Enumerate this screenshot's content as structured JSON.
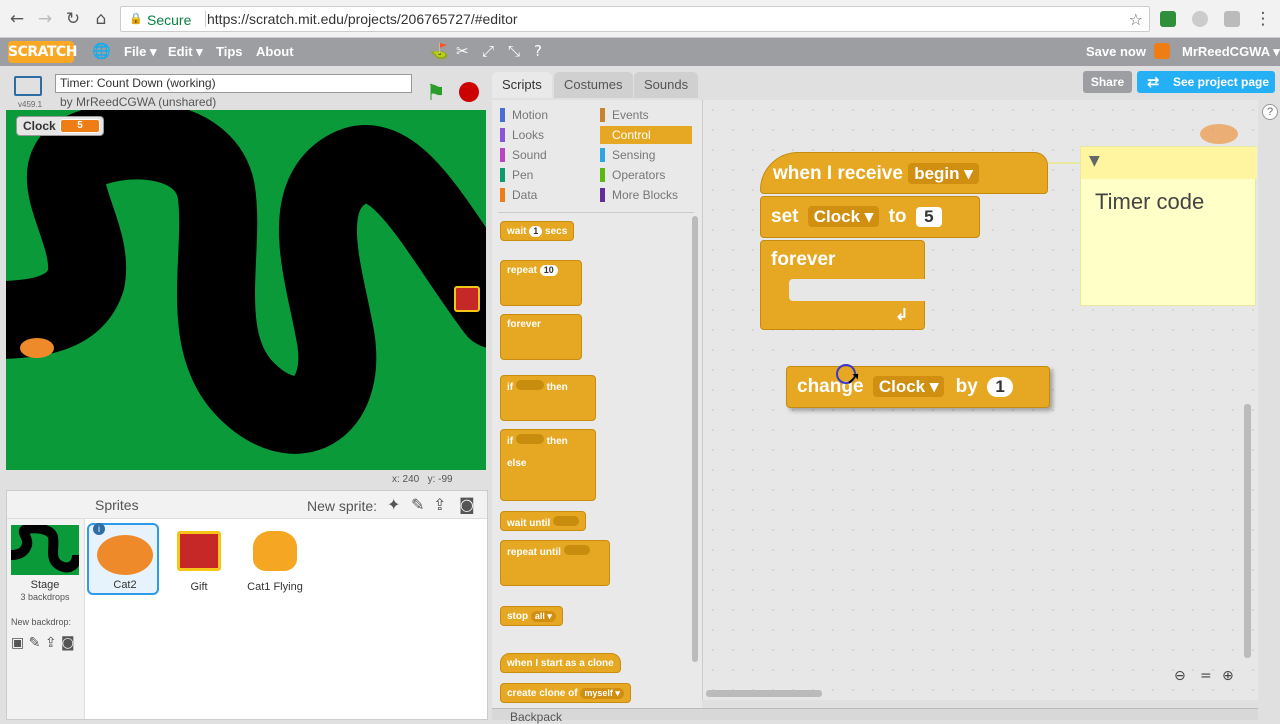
{
  "browser": {
    "secure_label": "Secure",
    "url": "https://scratch.mit.edu/projects/206765727/#editor"
  },
  "menubar": {
    "logo": "SCRATCH",
    "file": "File ▾",
    "edit": "Edit ▾",
    "tips": "Tips",
    "about": "About",
    "save_now": "Save now",
    "user": "MrReedCGWA ▾"
  },
  "project": {
    "title": "Timer: Count Down (working)",
    "byline": "by MrReedCGWA (unshared)",
    "version": "v459.1",
    "share": "Share",
    "see_project_page": "See project page"
  },
  "stage": {
    "monitor_label": "Clock",
    "monitor_value": "5",
    "coords_x": "x: 240",
    "coords_y": "y: -99"
  },
  "sprites": {
    "header": "Sprites",
    "new_sprite": "New sprite:",
    "stage_label": "Stage",
    "stage_backdrops": "3 backdrops",
    "new_backdrop": "New backdrop:",
    "list": [
      {
        "name": "Cat2"
      },
      {
        "name": "Gift"
      },
      {
        "name": "Cat1 Flying"
      }
    ]
  },
  "tabs": {
    "scripts": "Scripts",
    "costumes": "Costumes",
    "sounds": "Sounds"
  },
  "categories": {
    "motion": "Motion",
    "looks": "Looks",
    "sound": "Sound",
    "pen": "Pen",
    "data": "Data",
    "events": "Events",
    "control": "Control",
    "sensing": "Sensing",
    "operators": "Operators",
    "more_blocks": "More Blocks"
  },
  "palette": {
    "wait": "wait",
    "wait_num": "1",
    "secs": "secs",
    "repeat": "repeat",
    "repeat_num": "10",
    "forever": "forever",
    "if": "if",
    "then": "then",
    "else": "else",
    "wait_until": "wait until",
    "repeat_until": "repeat until",
    "stop": "stop",
    "stop_opt": "all ▾",
    "clone_start": "when I start as a clone",
    "create_clone": "create clone of",
    "create_clone_opt": "myself ▾"
  },
  "script": {
    "when_receive": "when I receive",
    "message": "begin",
    "set": "set",
    "set_var": "Clock",
    "to": "to",
    "set_value": "5",
    "forever": "forever",
    "change": "change",
    "change_var": "Clock",
    "by": "by",
    "change_value": "1",
    "comment": "Timer code"
  },
  "backpack": "Backpack",
  "colors": {
    "control": "#e6a822",
    "stage_green": "#0b9a3a",
    "accent_blue": "#25aff4"
  }
}
